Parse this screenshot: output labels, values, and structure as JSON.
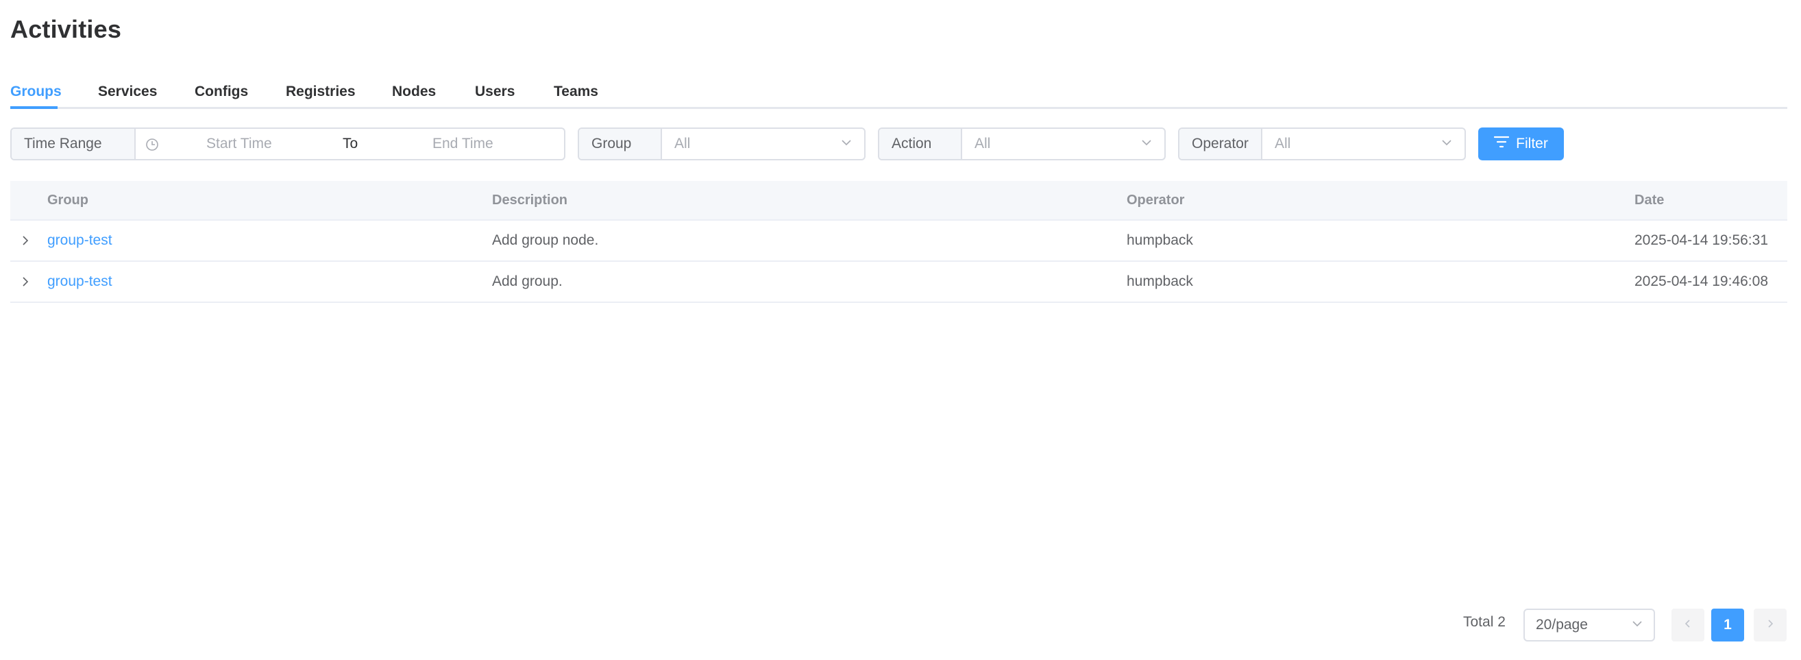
{
  "page": {
    "title": "Activities"
  },
  "tabs": [
    {
      "label": "Groups",
      "active": true
    },
    {
      "label": "Services",
      "active": false
    },
    {
      "label": "Configs",
      "active": false
    },
    {
      "label": "Registries",
      "active": false
    },
    {
      "label": "Nodes",
      "active": false
    },
    {
      "label": "Users",
      "active": false
    },
    {
      "label": "Teams",
      "active": false
    }
  ],
  "filters": {
    "time_range": {
      "label": "Time Range",
      "start_placeholder": "Start Time",
      "separator": "To",
      "end_placeholder": "End Time",
      "icon": "clock-icon"
    },
    "group": {
      "label": "Group",
      "value": "All"
    },
    "action": {
      "label": "Action",
      "value": "All"
    },
    "operator": {
      "label": "Operator",
      "value": "All"
    },
    "filter_button": {
      "label": "Filter",
      "icon": "filter-icon"
    }
  },
  "table": {
    "columns": [
      "Group",
      "Description",
      "Operator",
      "Date"
    ],
    "rows": [
      {
        "group": "group-test",
        "description": "Add group node.",
        "operator": "humpback",
        "date": "2025-04-14 19:56:31"
      },
      {
        "group": "group-test",
        "description": "Add group.",
        "operator": "humpback",
        "date": "2025-04-14 19:46:08"
      }
    ]
  },
  "pagination": {
    "total_text": "Total 2",
    "page_size": "20/page",
    "current_page": "1"
  },
  "colors": {
    "accent": "#409eff",
    "text": "#303133",
    "muted": "#909399",
    "border": "#dcdfe6"
  }
}
